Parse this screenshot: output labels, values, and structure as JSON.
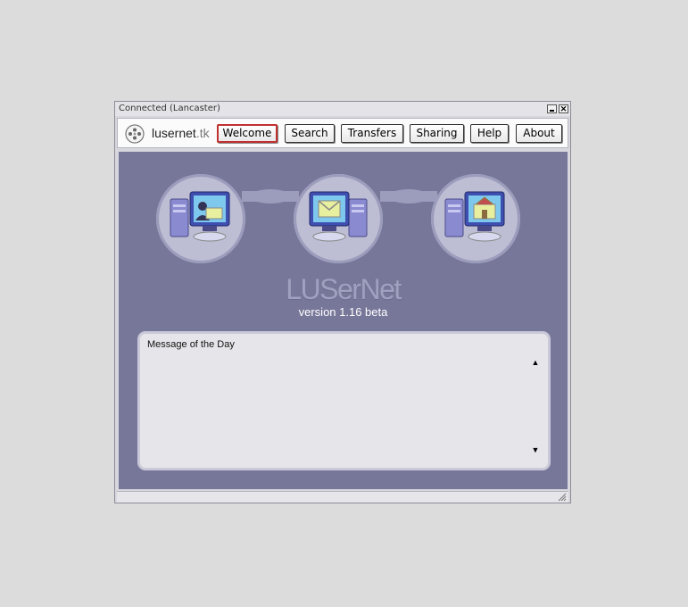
{
  "window": {
    "title": "Connected (Lancaster)",
    "minimize_label": "",
    "close_label": "✕"
  },
  "navbar": {
    "logo_name": "lusernet",
    "logo_suffix": ".tk",
    "buttons": [
      {
        "label": "Welcome",
        "active": true
      },
      {
        "label": "Search"
      },
      {
        "label": "Transfers"
      },
      {
        "label": "Sharing"
      },
      {
        "label": "Help"
      },
      {
        "label": "About"
      }
    ]
  },
  "hero": {
    "icons": [
      "computer-user-icon",
      "computer-network-icon",
      "computer-home-icon"
    ],
    "brand": "LUSerNet",
    "version": "version 1.16 beta"
  },
  "motd": {
    "title": "Message of the Day",
    "scroll_up": "▲",
    "scroll_down": "▼"
  },
  "colors": {
    "background": "#77779a",
    "accent_active": "#c03030",
    "brand_text": "#a0a0c0"
  }
}
